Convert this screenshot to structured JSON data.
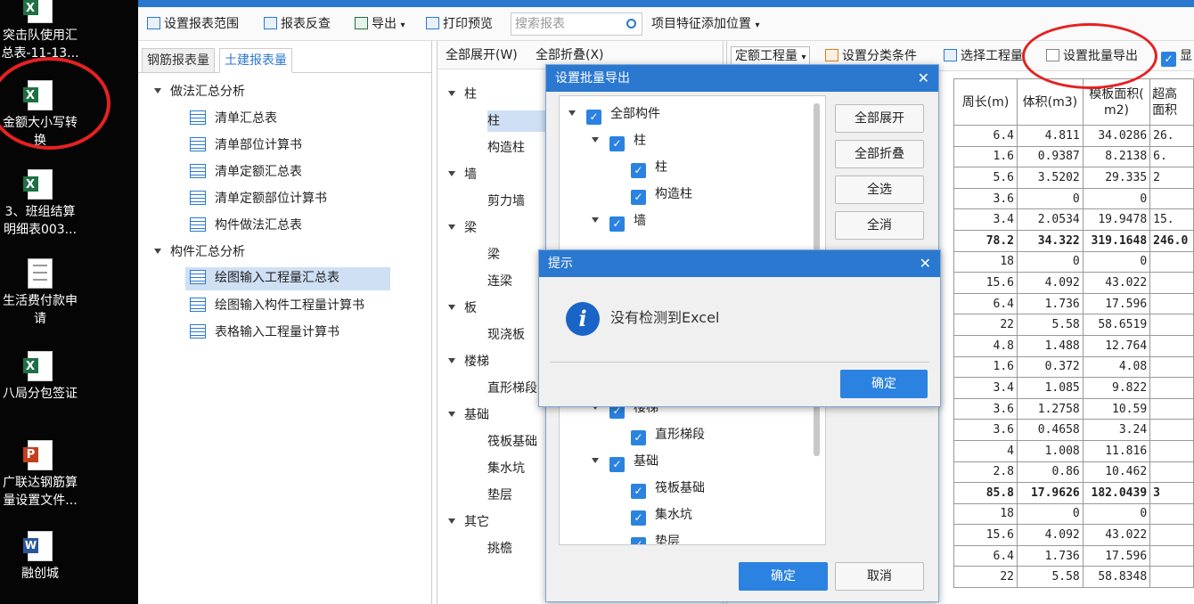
{
  "desktop": {
    "items": [
      {
        "label": "突击队使用汇\n总表-11-13...",
        "type": "excel"
      },
      {
        "label": "金额大小写转\n换",
        "type": "excel"
      },
      {
        "label": "3、班组结算\n明细表003...",
        "type": "excel"
      },
      {
        "label": "生活费付款申\n请",
        "type": "text"
      },
      {
        "label": "八局分包签证",
        "type": "excel"
      },
      {
        "label": "广联达钢筋算\n量设置文件...",
        "type": "ppt"
      },
      {
        "label": "融创城",
        "type": "word"
      }
    ]
  },
  "toolbar": {
    "set_range": "设置报表范围",
    "reverse": "报表反查",
    "export": "导出",
    "print_preview": "打印预览",
    "search_placeholder": "搜索报表",
    "add_position": "项目特征添加位置"
  },
  "left": {
    "tabs": [
      "钢筋报表量",
      "土建报表量"
    ],
    "groups": [
      {
        "label": "做法汇总分析",
        "items": [
          "清单汇总表",
          "清单部位计算书",
          "清单定额汇总表",
          "清单定额部位计算书",
          "构件做法汇总表"
        ]
      },
      {
        "label": "构件汇总分析",
        "items": [
          "绘图输入工程量汇总表",
          "绘图输入构件工程量计算书",
          "表格输入工程量计算书"
        ]
      }
    ]
  },
  "middle": {
    "expand_all": "全部展开(W)",
    "collapse_all": "全部折叠(X)",
    "tree": [
      {
        "label": "柱",
        "level": 0
      },
      {
        "label": "柱",
        "level": 1
      },
      {
        "label": "构造柱",
        "level": 1
      },
      {
        "label": "墙",
        "level": 0
      },
      {
        "label": "剪力墙",
        "level": 1
      },
      {
        "label": "梁",
        "level": 0
      },
      {
        "label": "梁",
        "level": 1
      },
      {
        "label": "连梁",
        "level": 1
      },
      {
        "label": "板",
        "level": 0
      },
      {
        "label": "现浇板",
        "level": 1
      },
      {
        "label": "楼梯",
        "level": 0
      },
      {
        "label": "直形梯段",
        "level": 1
      },
      {
        "label": "基础",
        "level": 0
      },
      {
        "label": "筏板基础",
        "level": 1
      },
      {
        "label": "集水坑",
        "level": 1
      },
      {
        "label": "垫层",
        "level": 1
      },
      {
        "label": "其它",
        "level": 0
      },
      {
        "label": "挑檐",
        "level": 1
      }
    ]
  },
  "right": {
    "quota": "定额工程量",
    "set_category": "设置分类条件",
    "select_quantity": "选择工程量",
    "batch_export": "设置批量导出",
    "display": "显",
    "headers": [
      "周长(m)",
      "体积(m3)",
      "模板面积(\nm2)",
      "超高\n面积"
    ],
    "rows": [
      [
        "6.4",
        "4.811",
        "34.0286",
        "26."
      ],
      [
        "1.6",
        "0.9387",
        "8.2138",
        "6."
      ],
      [
        "5.6",
        "3.5202",
        "29.335",
        "2"
      ],
      [
        "3.6",
        "0",
        "0",
        ""
      ],
      [
        "3.4",
        "2.0534",
        "19.9478",
        "15."
      ],
      [
        "78.2",
        "34.322",
        "319.1648",
        "246.0"
      ],
      [
        "18",
        "0",
        "0",
        ""
      ],
      [
        "15.6",
        "4.092",
        "43.022",
        ""
      ],
      [
        "6.4",
        "1.736",
        "17.596",
        ""
      ],
      [
        "22",
        "5.58",
        "58.6519",
        ""
      ],
      [
        "4.8",
        "1.488",
        "12.764",
        ""
      ],
      [
        "1.6",
        "0.372",
        "4.08",
        ""
      ],
      [
        "3.4",
        "1.085",
        "9.822",
        ""
      ],
      [
        "3.6",
        "1.2758",
        "10.59",
        ""
      ],
      [
        "3.6",
        "0.4658",
        "3.24",
        ""
      ],
      [
        "4",
        "1.008",
        "11.816",
        ""
      ],
      [
        "2.8",
        "0.86",
        "10.462",
        ""
      ],
      [
        "85.8",
        "17.9626",
        "182.0439",
        "3"
      ],
      [
        "18",
        "0",
        "0",
        ""
      ],
      [
        "15.6",
        "4.092",
        "43.022",
        ""
      ],
      [
        "6.4",
        "1.736",
        "17.596",
        ""
      ],
      [
        "22",
        "5.58",
        "58.8348",
        ""
      ]
    ]
  },
  "batch_dialog": {
    "title": "设置批量导出",
    "tree": [
      {
        "label": "全部构件",
        "level": 0
      },
      {
        "label": "柱",
        "level": 1
      },
      {
        "label": "柱",
        "level": 2
      },
      {
        "label": "构造柱",
        "level": 2
      },
      {
        "label": "墙",
        "level": 1
      },
      {
        "label": "楼梯",
        "level": 1
      },
      {
        "label": "直形梯段",
        "level": 2
      },
      {
        "label": "基础",
        "level": 1
      },
      {
        "label": "筏板基础",
        "level": 2
      },
      {
        "label": "集水坑",
        "level": 2
      },
      {
        "label": "垫层",
        "level": 2
      }
    ],
    "expand_all": "全部展开",
    "collapse_all": "全部折叠",
    "select_all": "全选",
    "deselect_all": "全消",
    "ok": "确定",
    "cancel": "取消"
  },
  "alert_dialog": {
    "title": "提示",
    "message": "没有检测到Excel",
    "ok": "确定"
  },
  "colors": {
    "accent": "#2b78d0",
    "annotation": "#e52121"
  }
}
